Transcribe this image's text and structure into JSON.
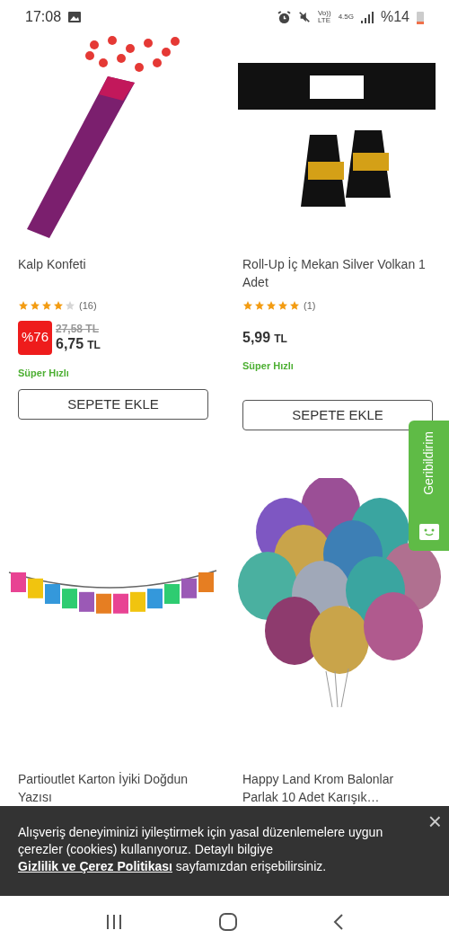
{
  "status_bar": {
    "time": "17:08",
    "volte_top": "Vo))",
    "volte_bottom": "LTE",
    "network": "4.5G",
    "battery": "%14"
  },
  "products": [
    {
      "title": "Kalp Konfeti",
      "stars": 4,
      "review_count": "(16)",
      "discount": "%76",
      "old_price": "27,58 TL",
      "price": "6,75",
      "currency": "TL",
      "delivery": "Süper Hızlı",
      "button": "SEPETE EKLE"
    },
    {
      "title": "Roll-Up İç Mekan Silver Volkan 1 Adet",
      "stars": 5,
      "review_count": "(1)",
      "price": "5,99",
      "currency": "TL",
      "delivery": "Süper Hızlı",
      "button": "SEPETE EKLE"
    },
    {
      "title": "Partioutlet Karton İyiki Doğdun Yazısı"
    },
    {
      "title": "Happy Land Krom Balonlar Parlak 10 Adet Karışık…"
    }
  ],
  "feedback_tab": {
    "label": "Geribildirim"
  },
  "cookie_banner": {
    "text_before": "Alışveriş deneyiminizi iyileştirmek için yasal düzenlemelere uygun çerezler (cookies) kullanıyoruz. Detaylı bilgiye ",
    "link": "Gizlilik ve Çerez Politikası",
    "text_after": " sayfamızdan erişebilirsiniz.",
    "close": "×"
  }
}
